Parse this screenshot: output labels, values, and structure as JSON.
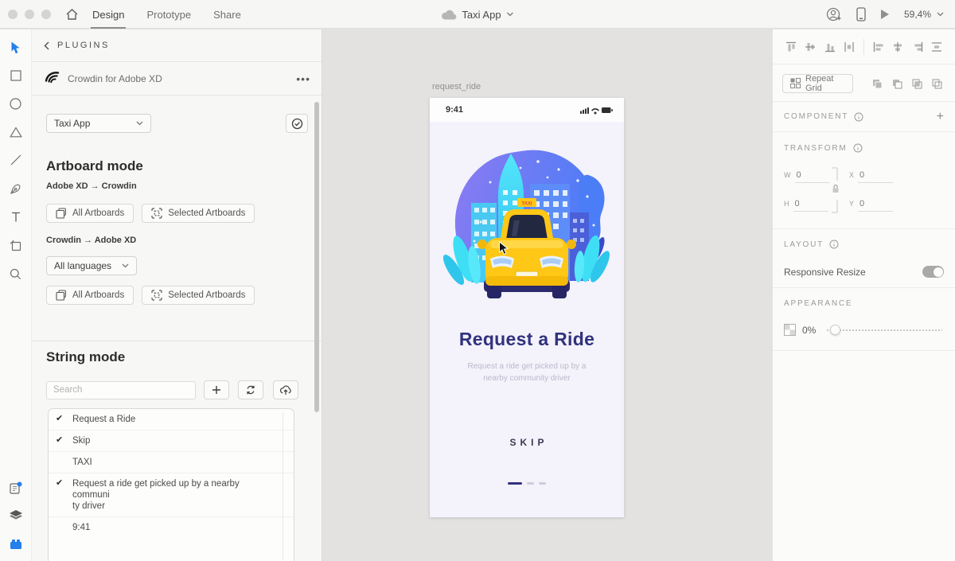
{
  "topbar": {
    "tabs": [
      {
        "label": "Design",
        "active": true
      },
      {
        "label": "Prototype",
        "active": false
      },
      {
        "label": "Share",
        "active": false
      }
    ],
    "document_title": "Taxi App",
    "zoom_level": "59,4%"
  },
  "left_toolbar": {
    "tools": [
      "select",
      "rectangle",
      "ellipse",
      "polygon",
      "line",
      "pen",
      "text",
      "artboard",
      "zoom"
    ],
    "bottom_tools": [
      "plugins-page",
      "layers",
      "plugins"
    ]
  },
  "plugins_panel": {
    "back_label": "PLUGINS",
    "plugin_title": "Crowdin for Adobe XD",
    "project_select_value": "Taxi App",
    "artboard_mode": {
      "heading": "Artboard mode",
      "xd_to_crowdin_label": "Adobe XD → Crowdin",
      "crowdin_to_xd_label": "Crowdin → Adobe XD",
      "all_artboards_label": "All Artboards",
      "selected_artboards_label": "Selected Artboards",
      "languages_select_value": "All languages"
    },
    "string_mode": {
      "heading": "String mode",
      "search_placeholder": "Search",
      "items": [
        {
          "check": "✔",
          "text": "Request a Ride"
        },
        {
          "check": "✔",
          "text": "Skip"
        },
        {
          "check": "",
          "text": "TAXI"
        },
        {
          "check": "✔",
          "text": "Request a ride get picked up by a nearby communi\nty driver"
        },
        {
          "check": "",
          "text": "9:41"
        }
      ]
    }
  },
  "canvas": {
    "artboard_label": "request_ride",
    "screen": {
      "status_time": "9:41",
      "taxi_sign": "TAXI",
      "title": "Request a Ride",
      "subtitle_line1": "Request a ride get picked up by a",
      "subtitle_line2": "nearby community driver",
      "skip_label": "SKIP"
    }
  },
  "right_panel": {
    "repeat_grid_label": "Repeat Grid",
    "component": {
      "heading": "COMPONENT",
      "add": "+"
    },
    "transform": {
      "heading": "TRANSFORM",
      "w_label": "W",
      "w_value": "0",
      "h_label": "H",
      "h_value": "0",
      "x_label": "X",
      "x_value": "0",
      "y_label": "Y",
      "y_value": "0"
    },
    "layout": {
      "heading": "LAYOUT",
      "responsive_resize_label": "Responsive Resize",
      "toggle_on": true
    },
    "appearance": {
      "heading": "APPEARANCE",
      "opacity_value": "0%"
    }
  },
  "colors": {
    "accent": "#2680eb",
    "title_navy": "#31327e",
    "taxi_yellow": "#ffc716",
    "canvas_bg": "#e3e2e1",
    "artboard_bg": "#f4f2fb"
  }
}
